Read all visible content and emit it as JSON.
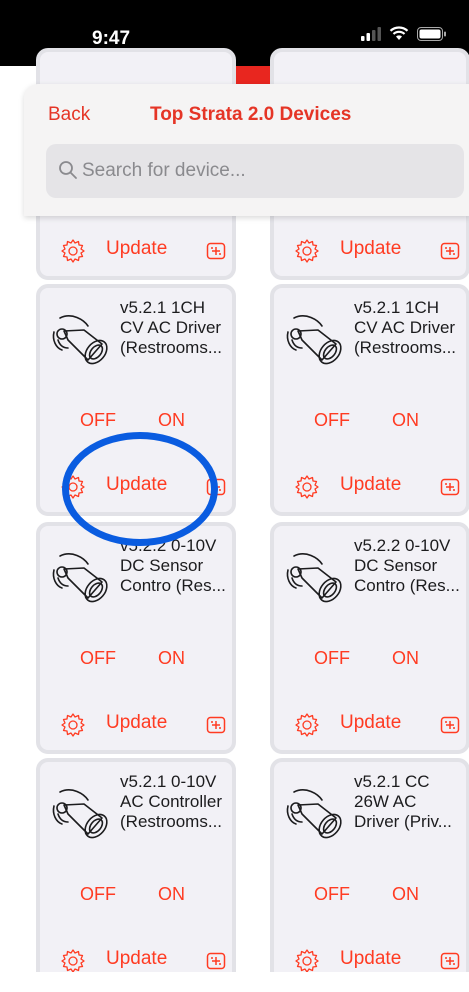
{
  "status_bar": {
    "time": "9:47"
  },
  "header": {
    "back_label": "Back",
    "title": "Top Strata 2.0 Devices"
  },
  "search": {
    "placeholder": "Search for device..."
  },
  "actions": {
    "off": "OFF",
    "on": "ON",
    "update": "Update"
  },
  "cards": [
    {
      "lines": [
        "",
        "",
        ""
      ]
    },
    {
      "lines": [
        "",
        "",
        ""
      ]
    },
    {
      "lines": [
        "v5.2.1 1CH",
        "CV AC Driver",
        "(Restrooms..."
      ]
    },
    {
      "lines": [
        "v5.2.1 1CH",
        "CV AC Driver",
        "(Restrooms..."
      ]
    },
    {
      "lines": [
        "v5.2.2 0-10V",
        "DC Sensor",
        "Contro (Res..."
      ]
    },
    {
      "lines": [
        "v5.2.2 0-10V",
        "DC Sensor",
        "Contro (Res..."
      ]
    },
    {
      "lines": [
        "v5.2.1 0-10V",
        "AC Controller",
        "(Restrooms..."
      ]
    },
    {
      "lines": [
        "v5.2.1 CC",
        "26W AC",
        "Driver (Priv..."
      ]
    }
  ],
  "colors": {
    "accent": "#ff3b22",
    "annotation": "#0a5ce0",
    "status_bg": "#000000"
  },
  "icons": [
    "signal-icon",
    "wifi-icon",
    "battery-icon",
    "search-icon",
    "light-fixture-icon",
    "gear-icon",
    "chip-icon"
  ]
}
